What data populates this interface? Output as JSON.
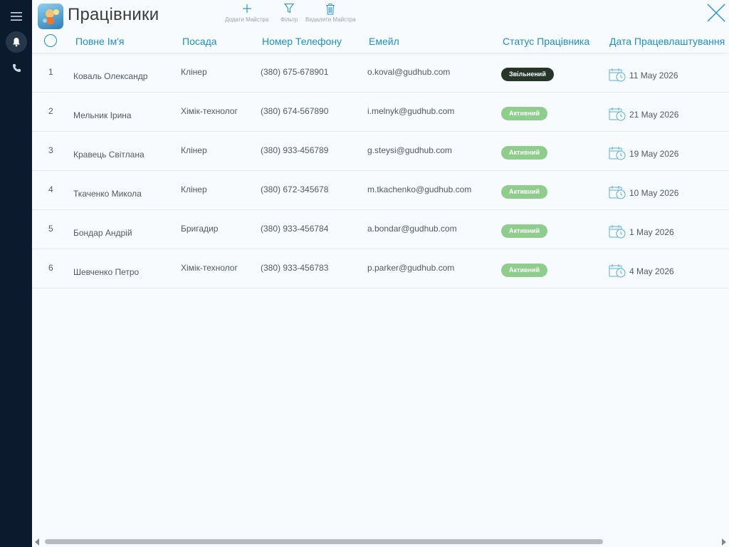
{
  "sidebar": {
    "icons": [
      "menu-icon",
      "bell-icon",
      "phone-icon"
    ]
  },
  "app": {
    "title": "Працівники",
    "logo": "app-logo-icon"
  },
  "toolbar": {
    "add_label": "Додати Майстра",
    "filter_label": "Фільтр",
    "delete_label": "Видалити Майстра"
  },
  "columns": {
    "name": "Повне Ім'я",
    "position": "Посада",
    "phone": "Номер Телефону",
    "email": "Емейл",
    "status": "Статус Працівника",
    "hire_date": "Дата Працевлаштування"
  },
  "rows": [
    {
      "num": "1",
      "name": "Коваль Олександр",
      "position": "Клінер",
      "phone": "(380) 675-678901",
      "email": "o.koval@gudhub.com",
      "status": "Звільнений",
      "status_color": "#263729",
      "date": "11 May 2026"
    },
    {
      "num": "2",
      "name": "Мельник Ірина",
      "position": "Хімік-технолог",
      "phone": "(380) 674-567890",
      "email": "i.melnyk@gudhub.com",
      "status": "Активний",
      "status_color": "#8fcd8c",
      "date": "21 May 2026"
    },
    {
      "num": "3",
      "name": "Кравець Світлана",
      "position": "Клінер",
      "phone": "(380) 933-456789",
      "email": "g.steysi@gudhub.com",
      "status": "Активний",
      "status_color": "#8fcd8c",
      "date": "19 May 2026"
    },
    {
      "num": "4",
      "name": "Ткаченко Микола",
      "position": "Клінер",
      "phone": "(380) 672-345678",
      "email": "m.tkachenko@gudhub.com",
      "status": "Активний",
      "status_color": "#8fcd8c",
      "date": "10 May 2026"
    },
    {
      "num": "5",
      "name": "Бондар Андрій",
      "position": "Бригадир",
      "phone": "(380) 933-456784",
      "email": "a.bondar@gudhub.com",
      "status": "Активний",
      "status_color": "#8fcd8c",
      "date": "1 May 2026"
    },
    {
      "num": "6",
      "name": "Шевченко Петро",
      "position": "Хімік-технолог",
      "phone": "(380) 933-456783",
      "email": "p.parker@gudhub.com",
      "status": "Активний",
      "status_color": "#8fcd8c",
      "date": "4 May 2026"
    }
  ],
  "colors": {
    "accent": "#1d8fc9",
    "sidebar": "#0b1a2c",
    "fired": "#263729",
    "active": "#8fcd8c"
  }
}
